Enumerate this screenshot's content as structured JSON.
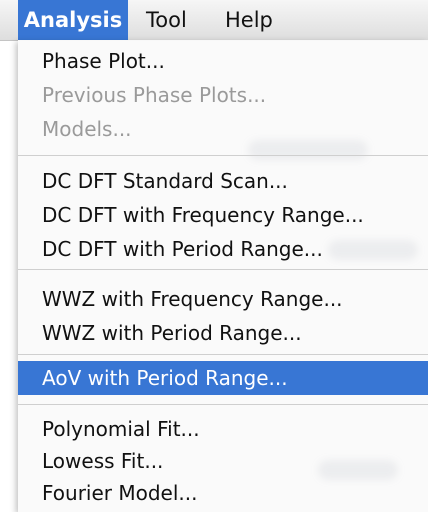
{
  "menubar": {
    "items": [
      {
        "label": "Analysis",
        "active": true
      },
      {
        "label": "Tool",
        "active": false
      },
      {
        "label": "Help",
        "active": false
      }
    ]
  },
  "menu": {
    "groups": [
      [
        {
          "label": "Phase Plot...",
          "enabled": true
        },
        {
          "label": "Previous Phase Plots...",
          "enabled": false
        },
        {
          "label": "Models...",
          "enabled": false
        }
      ],
      [
        {
          "label": "DC DFT Standard Scan...",
          "enabled": true
        },
        {
          "label": "DC DFT with Frequency Range...",
          "enabled": true
        },
        {
          "label": "DC DFT with Period Range...",
          "enabled": true
        }
      ],
      [
        {
          "label": "WWZ with Frequency Range...",
          "enabled": true
        },
        {
          "label": "WWZ with Period Range...",
          "enabled": true
        }
      ],
      [
        {
          "label": "AoV with Period Range...",
          "enabled": true,
          "selected": true
        }
      ],
      [
        {
          "label": "Polynomial Fit...",
          "enabled": true
        },
        {
          "label": "Lowess Fit...",
          "enabled": true
        },
        {
          "label": "Fourier Model...",
          "enabled": true
        }
      ]
    ]
  },
  "colors": {
    "highlight": "#3876d4",
    "disabled_text": "#9a9a9a",
    "separator": "#cfcfcf"
  }
}
